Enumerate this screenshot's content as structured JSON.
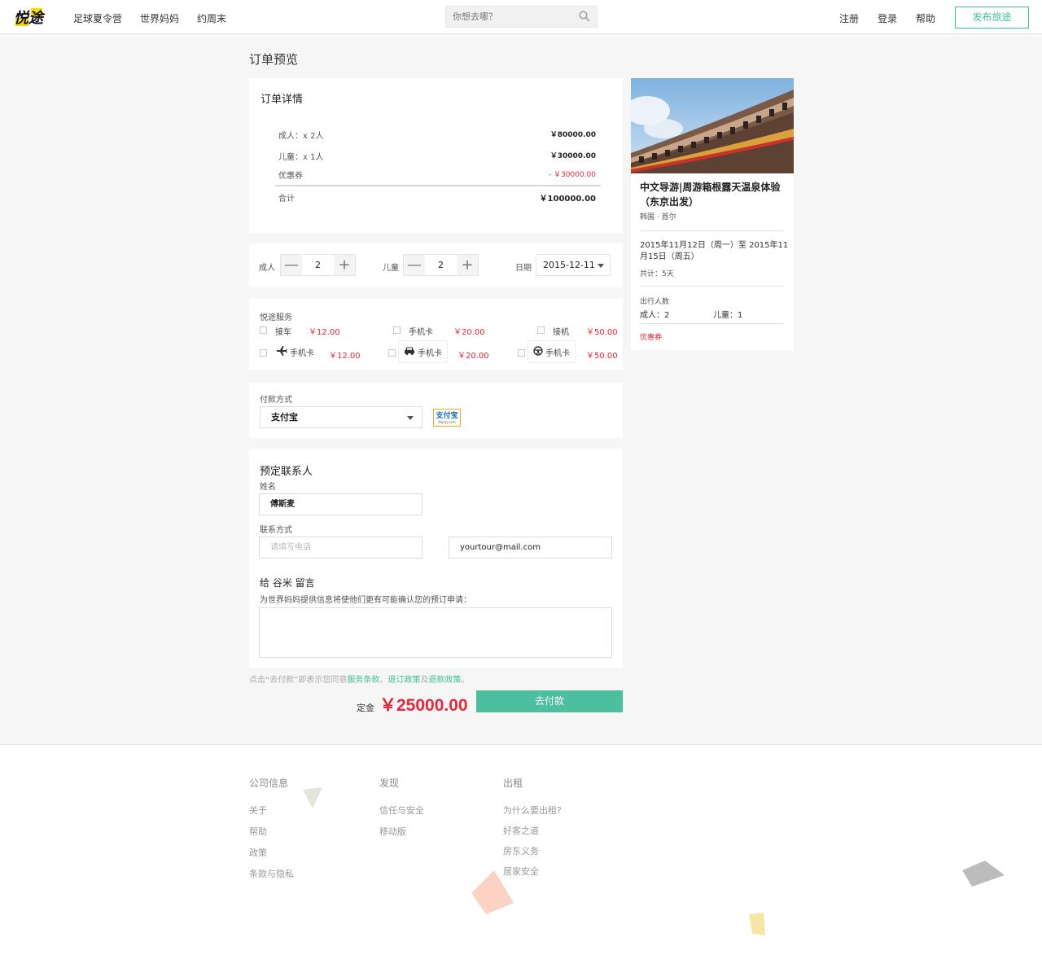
{
  "header": {
    "logo_text": "悦途",
    "nav": [
      "足球夏令营",
      "世界妈妈",
      "约周末"
    ],
    "search_placeholder": "你想去哪？",
    "links": [
      "注册",
      "登录",
      "帮助"
    ],
    "publish_label": "发布旅途"
  },
  "page_title": "订单预览",
  "order": {
    "title": "订单详情",
    "rows": [
      {
        "label": "成人：x 2人",
        "amount": "￥80000.00"
      },
      {
        "label": "儿童：x 1人",
        "amount": "￥30000.00"
      },
      {
        "label": "优惠券",
        "amount": "- ￥30000.00"
      }
    ],
    "total_label": "合计",
    "total_amount": "￥100000.00"
  },
  "counters": {
    "adult_label": "成人",
    "adult_value": "2",
    "child_label": "儿童",
    "child_value": "2",
    "date_label": "日期",
    "date_value": "2015-12-11"
  },
  "services": {
    "title": "悦途服务",
    "row1": [
      {
        "name": "接车",
        "price": "￥12.00"
      },
      {
        "name": "手机卡",
        "price": "￥20.00"
      },
      {
        "name": "接机",
        "price": "￥50.00"
      }
    ],
    "row2": [
      {
        "name": "手机卡",
        "price": "￥12.00",
        "icon": "airplane-icon"
      },
      {
        "name": "手机卡",
        "price": "￥20.00",
        "icon": "car-icon"
      },
      {
        "name": "手机卡",
        "price": "￥50.00",
        "icon": "steering-wheel-icon"
      }
    ]
  },
  "payment": {
    "title": "付款方式",
    "selected": "支付宝",
    "logo_text": "支付宝",
    "logo_url_text": "Alipay.com"
  },
  "contact": {
    "title": "预定联系人",
    "name_label": "姓名",
    "name_value": "傅斯麦",
    "method_label": "联系方式",
    "phone_placeholder": "请填写电话",
    "email_value": "yourtour@mail.com",
    "message_title": "给 谷米 留言",
    "message_hint": "为世界妈妈提供信息将使他们更有可能确认您的预订申请："
  },
  "agree": {
    "prefix": "点击“去付款”即表示您同意",
    "link1": "服务条款",
    "sep1": "、",
    "link2": "退订政策",
    "sep2": "及",
    "link3": "退款政策",
    "suffix": "。"
  },
  "deposit": {
    "label": "定金",
    "amount": "￥25000.00"
  },
  "pay_button": "去付款",
  "trip": {
    "name": "中文导游|周游箱根露天温泉体验（东京出发）",
    "location": "韩国 · 首尔",
    "dates": "2015年11月12日（周一）至 2015年11月15日（周五）",
    "total": "共计：5天",
    "people_title": "出行人数",
    "adults": "成人：2",
    "children": "儿童：1",
    "coupon": "优惠券"
  },
  "footer": {
    "col1": {
      "title": "公司信息",
      "items": [
        "关于",
        "帮助",
        "政策",
        "条款与隐私"
      ]
    },
    "col2": {
      "title": "发现",
      "items": [
        "信任与安全",
        "移动版"
      ]
    },
    "col3": {
      "title": "出租",
      "items": [
        "为什么要出租?",
        "好客之道",
        "房东义务",
        "居家安全"
      ]
    }
  },
  "colors": {
    "accent": "#3fc19a",
    "price_red": "#e8273b",
    "pay_button": "#4cbf9e",
    "logo_yellow": "#f5d90a"
  }
}
